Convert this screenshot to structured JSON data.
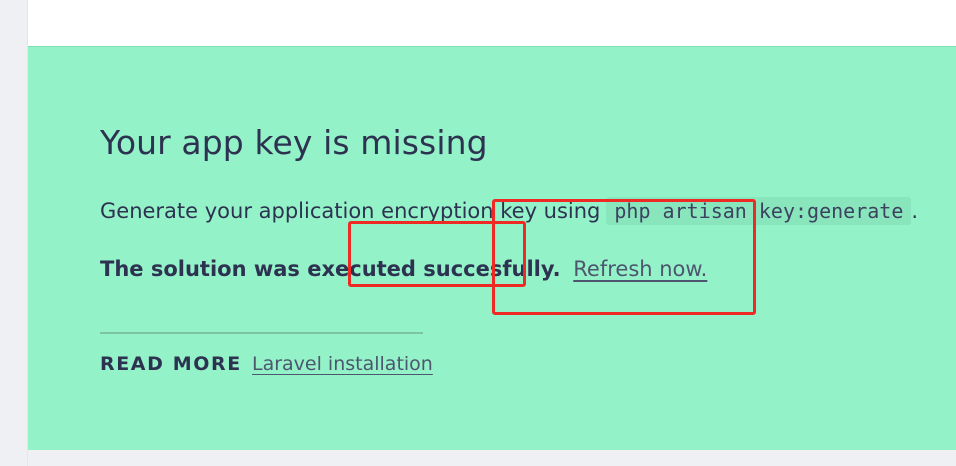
{
  "solution": {
    "title": "Your app key is missing",
    "description_prefix": "Generate your application encryption key using",
    "command": "php artisan key:generate",
    "description_suffix": ".",
    "result_message": "The solution was executed succesfully.",
    "refresh_link": "Refresh now."
  },
  "links": {
    "read_more_label": "READ MORE",
    "items": [
      "Laravel installation"
    ]
  },
  "colors": {
    "panel_background": "#94f2c8",
    "text": "#2d3250",
    "annotation_red": "#ee2a24"
  }
}
